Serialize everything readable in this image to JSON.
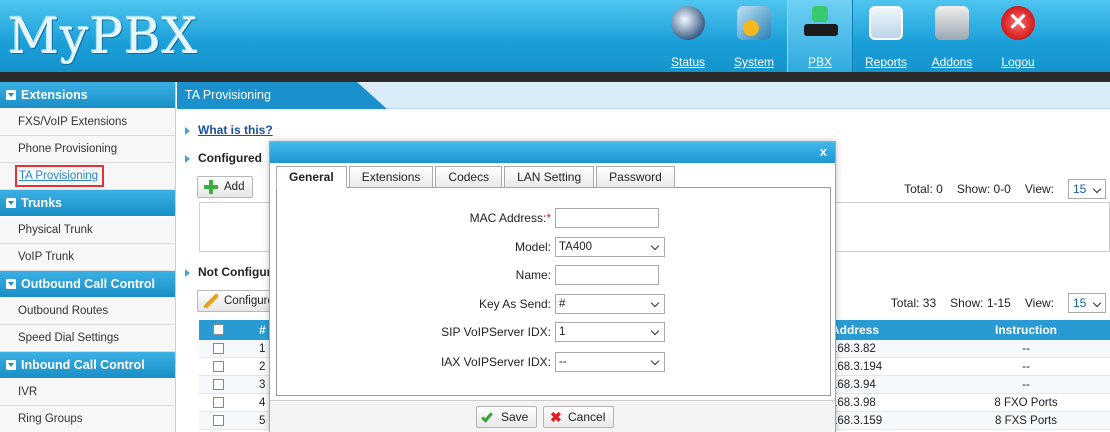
{
  "brand": {
    "logo": "MyPBX"
  },
  "nav": [
    {
      "label": "Status",
      "icon": "status-icon"
    },
    {
      "label": "System",
      "icon": "system-icon"
    },
    {
      "label": "PBX",
      "icon": "pbx-icon",
      "active": true
    },
    {
      "label": "Reports",
      "icon": "reports-icon"
    },
    {
      "label": "Addons",
      "icon": "addons-icon"
    },
    {
      "label": "Logou",
      "icon": "logout-icon"
    }
  ],
  "sidebar": {
    "extensions": {
      "title": "Extensions",
      "items": [
        "FXS/VoIP Extensions",
        "Phone Provisioning",
        "TA Provisioning"
      ]
    },
    "trunks": {
      "title": "Trunks",
      "items": [
        "Physical Trunk",
        "VoIP Trunk"
      ]
    },
    "outbound": {
      "title": "Outbound Call Control",
      "items": [
        "Outbound Routes",
        "Speed Dial Settings"
      ]
    },
    "inbound": {
      "title": "Inbound Call Control",
      "items": [
        "IVR",
        "Ring Groups"
      ]
    }
  },
  "page": {
    "tab": "TA Provisioning",
    "what_is_this": "What is this?",
    "configured": {
      "title": "Configured",
      "add_label": "Add",
      "total": "Total: 0",
      "show": "Show: 0-0",
      "view_label": "View:",
      "view_value": "15"
    },
    "not_configured": {
      "title": "Not Configur",
      "configure_label": "Configure",
      "total": "Total: 33",
      "show": "Show: 1-15",
      "view_label": "View:",
      "view_value": "15",
      "columns": {
        "num": "#",
        "address": "Address",
        "instruction": "Instruction"
      },
      "rows": [
        {
          "num": "1",
          "address": "168.3.82",
          "instruction": "--"
        },
        {
          "num": "2",
          "address": "168.3.194",
          "instruction": "--"
        },
        {
          "num": "3",
          "address": "168.3.94",
          "instruction": "--"
        },
        {
          "num": "4",
          "address": "168.3.98",
          "instruction": "8 FXO Ports"
        },
        {
          "num": "5",
          "address": "168.3.159",
          "instruction": "8 FXS Ports"
        }
      ]
    }
  },
  "modal": {
    "close": "x",
    "tabs": [
      "General",
      "Extensions",
      "Codecs",
      "LAN Setting",
      "Password"
    ],
    "fields": {
      "mac": {
        "label": "MAC Address:",
        "required": "*",
        "value": ""
      },
      "model": {
        "label": "Model:",
        "value": "TA400"
      },
      "name": {
        "label": "Name:",
        "value": ""
      },
      "key_as_send": {
        "label": "Key As Send:",
        "value": "#"
      },
      "sip": {
        "label": "SIP VoIPServer IDX:",
        "value": "1"
      },
      "iax": {
        "label": "IAX VoIPServer IDX:",
        "value": "--"
      }
    },
    "save": "Save",
    "cancel": "Cancel"
  }
}
